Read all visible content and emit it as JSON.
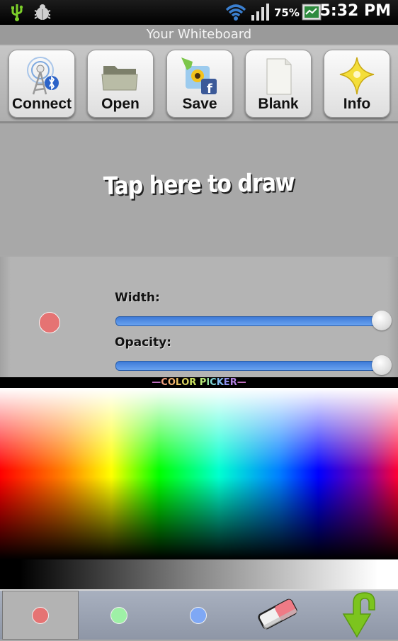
{
  "status_bar": {
    "icons": [
      "usb-icon",
      "debug-bug-icon",
      "wifi-icon",
      "signal-icon",
      "battery-icon"
    ],
    "battery": "75%",
    "time": "5:32 PM"
  },
  "app": {
    "title": "Your Whiteboard"
  },
  "toolbar": {
    "buttons": [
      {
        "label": "Connect",
        "icon": "bluetooth-tower-icon"
      },
      {
        "label": "Open",
        "icon": "folder-icon"
      },
      {
        "label": "Save",
        "icon": "save-photo-facebook-icon"
      },
      {
        "label": "Blank",
        "icon": "blank-page-icon"
      },
      {
        "label": "Info",
        "icon": "star-icon"
      }
    ]
  },
  "canvas": {
    "prompt": "Tap here to draw"
  },
  "brush": {
    "preview_color": "#e57373",
    "width_label": "Width:",
    "width_value": 1.0,
    "opacity_label": "Opacity:",
    "opacity_value": 1.0
  },
  "color_picker": {
    "header_dash_left": "—",
    "header_letters": [
      "C",
      "O",
      "L",
      "O",
      "R",
      " ",
      "P",
      "I",
      "C",
      "K",
      "E",
      "R"
    ],
    "header_dash_right": "—",
    "header_colors": [
      "#f0a080",
      "#f0b070",
      "#e8c060",
      "#d8d060",
      "#c8e060",
      "#000",
      "#b8e878",
      "#90e0a0",
      "#80d8d8",
      "#80b8f0",
      "#9090f0",
      "#b080e0"
    ],
    "dash_color": "#c070c0"
  },
  "palette": {
    "slots": [
      {
        "type": "color",
        "color": "#e57373",
        "selected": true
      },
      {
        "type": "color",
        "color": "#9ef0a6",
        "selected": false
      },
      {
        "type": "color",
        "color": "#7fa8f5",
        "selected": false
      },
      {
        "type": "eraser",
        "icon": "eraser-icon"
      },
      {
        "type": "action",
        "icon": "green-down-arrow-icon"
      }
    ]
  }
}
